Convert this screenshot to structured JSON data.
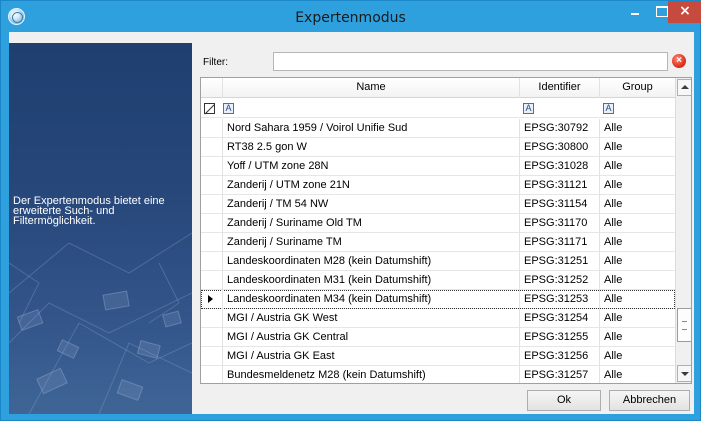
{
  "window": {
    "title": "Expertenmodus"
  },
  "side_panel": {
    "text": "Der Expertenmodus bietet eine erweiterte Such- und Filtermöglichkeit."
  },
  "filter": {
    "label": "Filter:",
    "value": "",
    "placeholder": ""
  },
  "grid": {
    "columns": [
      "Name",
      "Identifier",
      "Group"
    ],
    "filter_icon_letter": "A",
    "selected_index": 9,
    "rows": [
      {
        "name": "Nord Sahara 1959 / Voirol Unifie Sud",
        "id": "EPSG:30792",
        "group": "Alle"
      },
      {
        "name": "RT38 2.5 gon W",
        "id": "EPSG:30800",
        "group": "Alle"
      },
      {
        "name": "Yoff / UTM zone 28N",
        "id": "EPSG:31028",
        "group": "Alle"
      },
      {
        "name": "Zanderij / UTM zone 21N",
        "id": "EPSG:31121",
        "group": "Alle"
      },
      {
        "name": "Zanderij / TM 54 NW",
        "id": "EPSG:31154",
        "group": "Alle"
      },
      {
        "name": "Zanderij / Suriname Old TM",
        "id": "EPSG:31170",
        "group": "Alle"
      },
      {
        "name": "Zanderij / Suriname TM",
        "id": "EPSG:31171",
        "group": "Alle"
      },
      {
        "name": "Landeskoordinaten M28 (kein Datumshift)",
        "id": "EPSG:31251",
        "group": "Alle"
      },
      {
        "name": "Landeskoordinaten M31 (kein Datumshift)",
        "id": "EPSG:31252",
        "group": "Alle"
      },
      {
        "name": "Landeskoordinaten M34 (kein Datumshift)",
        "id": "EPSG:31253",
        "group": "Alle"
      },
      {
        "name": "MGI / Austria GK West",
        "id": "EPSG:31254",
        "group": "Alle"
      },
      {
        "name": "MGI / Austria GK Central",
        "id": "EPSG:31255",
        "group": "Alle"
      },
      {
        "name": "MGI / Austria GK East",
        "id": "EPSG:31256",
        "group": "Alle"
      },
      {
        "name": "Bundesmeldenetz M28 (kein Datumshift)",
        "id": "EPSG:31257",
        "group": "Alle"
      }
    ]
  },
  "buttons": {
    "ok": "Ok",
    "cancel": "Abbrechen"
  },
  "colors": {
    "titlebar": "#2ea0dd",
    "close": "#c74a3f",
    "panel": "#27477a"
  }
}
